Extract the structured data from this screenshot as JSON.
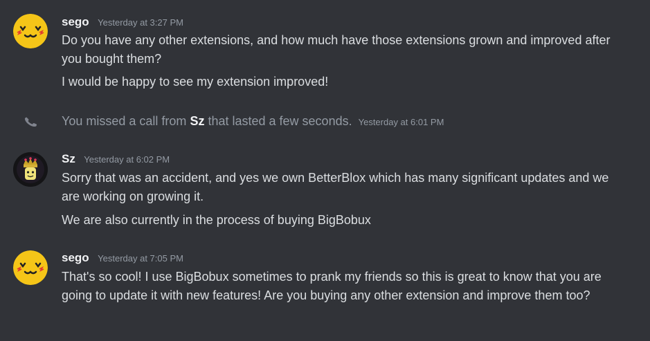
{
  "messages": [
    {
      "author": "sego",
      "timestamp": "Yesterday at 3:27 PM",
      "avatar_icon": "sego-face-avatar",
      "lines": [
        "Do you have any other extensions, and how much have those extensions grown and improved after you bought them?",
        "I would be happy to see my extension improved!"
      ]
    },
    {
      "author": "Sz",
      "timestamp": "Yesterday at 6:02 PM",
      "avatar_icon": "crowned-figure-avatar",
      "lines": [
        "Sorry that was an accident, and yes we own BetterBlox which has many significant updates and we are working on growing it.",
        "We are also currently in the process of buying BigBobux"
      ]
    },
    {
      "author": "sego",
      "timestamp": "Yesterday at 7:05 PM",
      "avatar_icon": "sego-face-avatar",
      "lines": [
        "That's so cool! I use BigBobux sometimes to prank my friends so this is great to know that you are going to update it with new features! Are you buying any other extension and improve them too?"
      ]
    }
  ],
  "system_message": {
    "icon": "phone-missed-icon",
    "prefix": "You missed a call from",
    "caller": "Sz",
    "suffix": "that lasted a few seconds.",
    "timestamp": "Yesterday at 6:01 PM"
  },
  "colors": {
    "background": "#313338",
    "text": "#dbdee1",
    "muted": "#949ba4",
    "username": "#f2f3f5",
    "avatar_yellow": "#f5c518"
  }
}
